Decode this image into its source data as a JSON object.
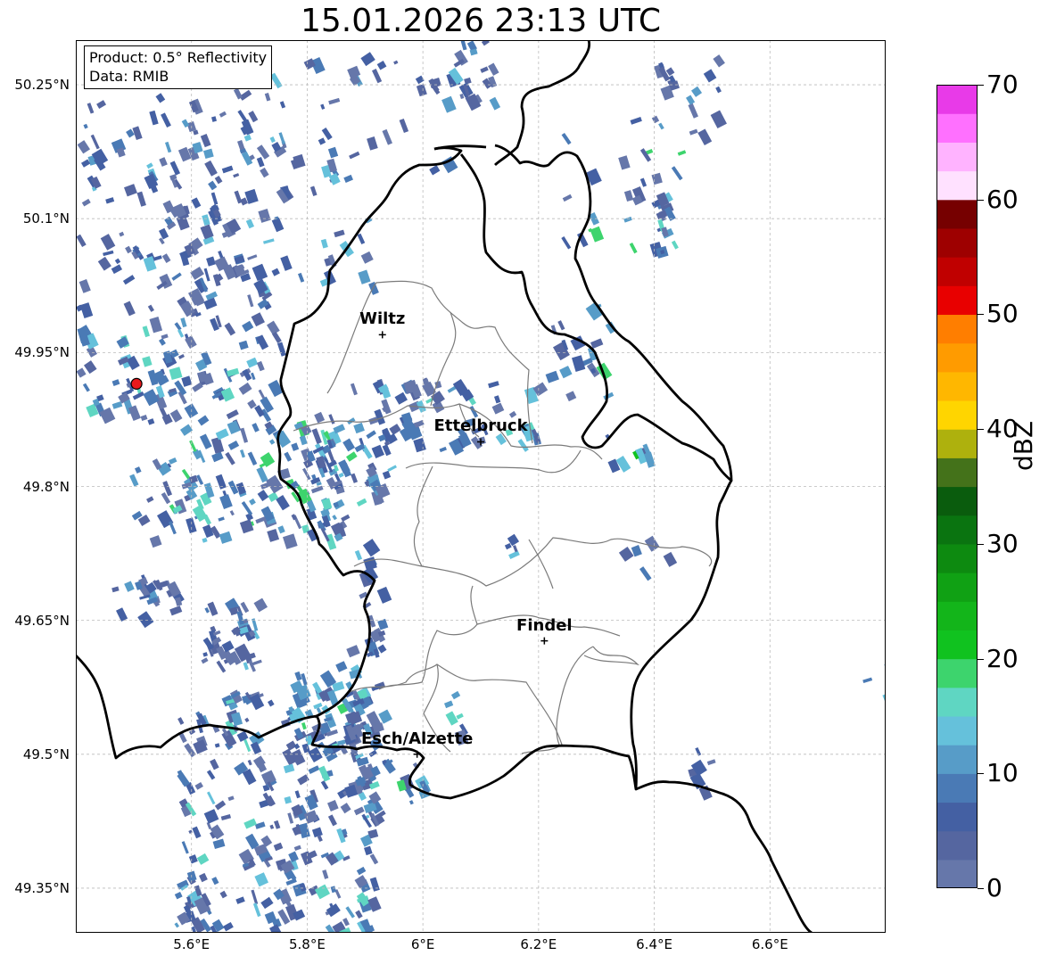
{
  "title": "15.01.2026 23:13 UTC",
  "info_box": {
    "product": "Product: 0.5° Reflectivity",
    "data": "Data: RMIB"
  },
  "map": {
    "lon_range": [
      5.4,
      6.8
    ],
    "lat_range": [
      49.3,
      50.3
    ],
    "lat_ticks": [
      {
        "value": 50.25,
        "label": "50.25°N"
      },
      {
        "value": 50.1,
        "label": "50.1°N"
      },
      {
        "value": 49.95,
        "label": "49.95°N"
      },
      {
        "value": 49.8,
        "label": "49.8°N"
      },
      {
        "value": 49.65,
        "label": "49.65°N"
      },
      {
        "value": 49.5,
        "label": "49.5°N"
      },
      {
        "value": 49.35,
        "label": "49.35°N"
      }
    ],
    "lon_ticks": [
      {
        "value": 5.6,
        "label": "5.6°E"
      },
      {
        "value": 5.8,
        "label": "5.8°E"
      },
      {
        "value": 6.0,
        "label": "6°E"
      },
      {
        "value": 6.2,
        "label": "6.2°E"
      },
      {
        "value": 6.4,
        "label": "6.4°E"
      },
      {
        "value": 6.6,
        "label": "6.6°E"
      }
    ],
    "cities": [
      {
        "name": "Wiltz",
        "lon": 5.93,
        "lat": 49.97
      },
      {
        "name": "Ettelbruck",
        "lon": 6.1,
        "lat": 49.85
      },
      {
        "name": "Findel",
        "lon": 6.21,
        "lat": 49.627
      },
      {
        "name": "Esch/Alzette",
        "lon": 5.99,
        "lat": 49.5
      }
    ],
    "radar_site": {
      "lon": 5.505,
      "lat": 49.915,
      "color": "#e8191c"
    }
  },
  "colorbar": {
    "label": "dBZ",
    "min": 0,
    "max": 70,
    "ticks": [
      "0",
      "10",
      "20",
      "30",
      "40",
      "50",
      "60",
      "70"
    ],
    "colors": [
      "#6677aa",
      "#5566a0",
      "#4460a3",
      "#4a7ab5",
      "#579cc8",
      "#65c1db",
      "#5fd6c2",
      "#3dd46d",
      "#10c21f",
      "#13b51a",
      "#10a114",
      "#0d8a10",
      "#0a7410",
      "#0a5c0d",
      "#44721a",
      "#aeb10d",
      "#ffd500",
      "#ffb700",
      "#ff9b00",
      "#ff7e00",
      "#e80000",
      "#c00000",
      "#9e0000",
      "#760000",
      "#ffe1ff",
      "#ffb3ff",
      "#ff70ff",
      "#e83ae8"
    ]
  }
}
